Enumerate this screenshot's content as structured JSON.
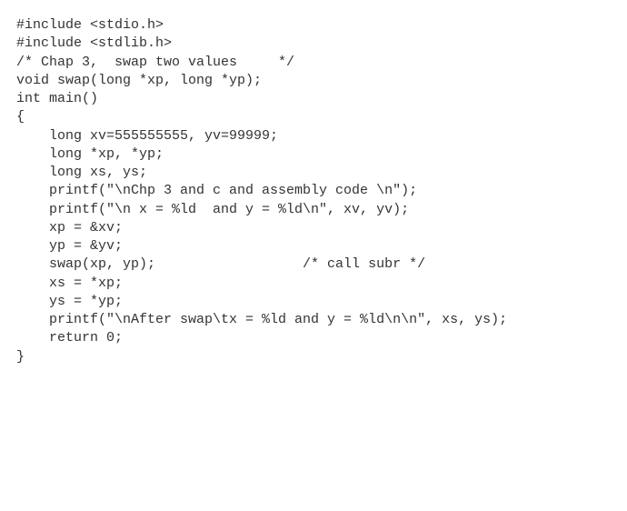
{
  "code": {
    "lines": [
      "#include <stdio.h>",
      "#include <stdlib.h>",
      "/* Chap 3,  swap two values     */",
      "",
      "",
      "void swap(long *xp, long *yp);",
      "",
      "int main()",
      "{",
      "    long xv=555555555, yv=99999;",
      "    long *xp, *yp;",
      "    long xs, ys;",
      "",
      "    printf(\"\\nChp 3 and c and assembly code \\n\");",
      "    printf(\"\\n x = %ld  and y = %ld\\n\", xv, yv);",
      "",
      "    xp = &xv;",
      "    yp = &yv;",
      "",
      "    swap(xp, yp);                  /* call subr */",
      "    xs = *xp;",
      "    ys = *yp;",
      "",
      "    printf(\"\\nAfter swap\\tx = %ld and y = %ld\\n\\n\", xs, ys);",
      "    return 0;",
      "}"
    ]
  }
}
